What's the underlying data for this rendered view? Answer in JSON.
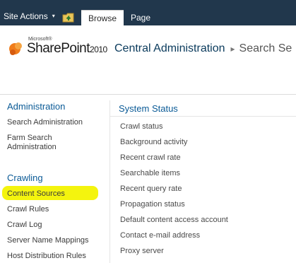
{
  "ribbon": {
    "site_actions_label": "Site Actions",
    "site_actions_caret": "▾",
    "tabs": [
      {
        "label": "Browse"
      },
      {
        "label": "Page"
      }
    ]
  },
  "logo": {
    "maker": "Microsoft®",
    "product": "SharePoint",
    "year": "2010"
  },
  "breadcrumb": {
    "items": [
      "Central Administration",
      "Search Se"
    ],
    "separator": "▸"
  },
  "left_nav": {
    "groups": [
      {
        "heading": "Administration",
        "items": [
          "Search Administration",
          "Farm Search Administration"
        ]
      },
      {
        "heading": "Crawling",
        "items": [
          "Content Sources",
          "Crawl Rules",
          "Crawl Log",
          "Server Name Mappings",
          "Host Distribution Rules"
        ]
      }
    ]
  },
  "main": {
    "section_title": "System Status",
    "status_items": [
      "Crawl status",
      "Background activity",
      "Recent crawl rate",
      "Searchable items",
      "Recent query rate",
      "Propagation status",
      "Default content access account",
      "Contact e-mail address",
      "Proxy server"
    ]
  },
  "colors": {
    "ribbon_bg": "#21374c",
    "heading_blue": "#0a5a96",
    "highlight": "#f4f40e"
  }
}
